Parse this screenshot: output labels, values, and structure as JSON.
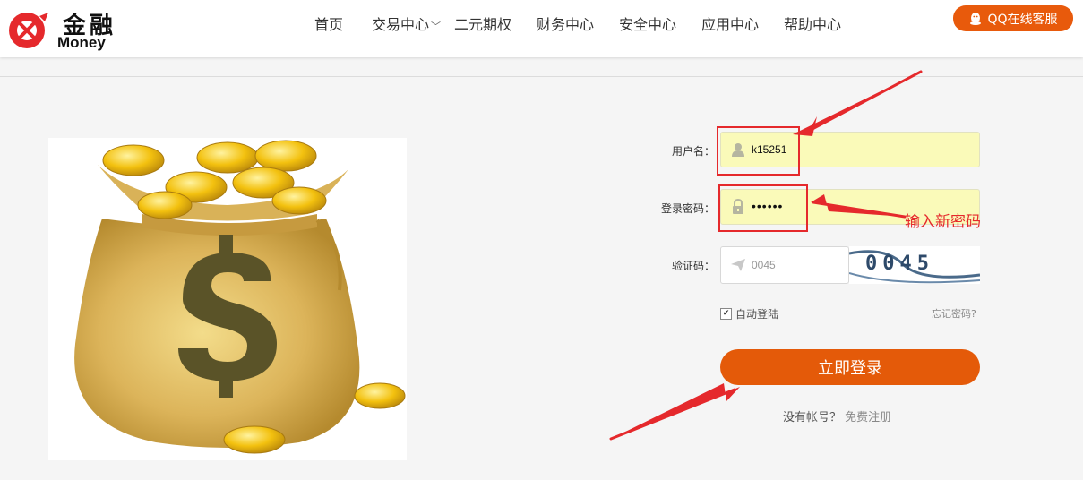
{
  "brand": {
    "name_cn": "金融",
    "name_en": "Money"
  },
  "nav": {
    "items": [
      {
        "label": "首页"
      },
      {
        "label": "交易中心",
        "has_dropdown": true
      },
      {
        "label": "二元期权"
      },
      {
        "label": "财务中心"
      },
      {
        "label": "安全中心"
      },
      {
        "label": "应用中心"
      },
      {
        "label": "帮助中心"
      }
    ]
  },
  "support": {
    "qq_label": "QQ在线客服",
    "icon": "qq-penguin-icon"
  },
  "login": {
    "username_label": "用户名：",
    "username_value": "k15251",
    "username_icon": "user-icon",
    "password_label": "登录密码：",
    "password_value": "••••••",
    "password_icon": "lock-icon",
    "captcha_label": "验证码：",
    "captcha_placeholder": "0045",
    "captcha_icon": "send-icon",
    "captcha_image_text": "0045",
    "remember_label": "自动登陆",
    "remember_checked": true,
    "forgot_label": "忘记密码?",
    "submit_label": "立即登录",
    "no_account_label": "没有帐号？",
    "register_label": "免费注册"
  },
  "annotation": {
    "note": "输入新密码",
    "color": "#e5292c"
  },
  "colors": {
    "accent": "#e45a09",
    "input_bg": "#fafab9"
  }
}
